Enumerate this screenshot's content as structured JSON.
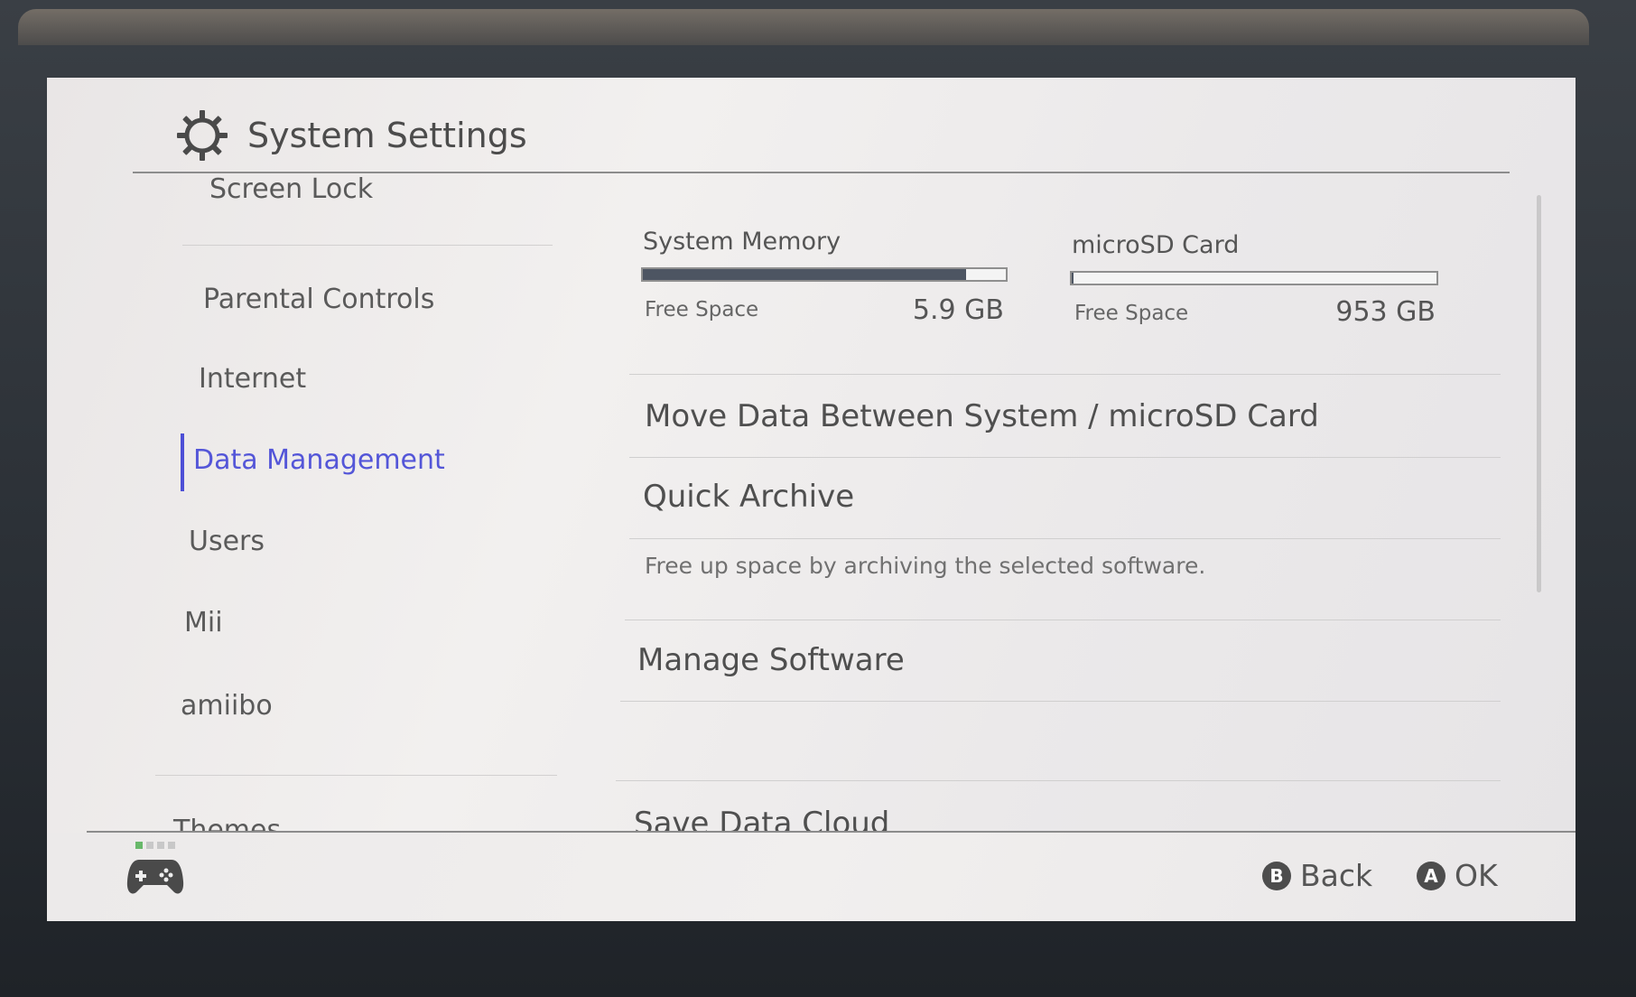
{
  "header": {
    "title": "System Settings",
    "icon": "gear-icon"
  },
  "sidebar": {
    "items": [
      {
        "label": "Screen Lock",
        "active": false
      },
      {
        "label": "Parental Controls",
        "active": false
      },
      {
        "label": "Internet",
        "active": false
      },
      {
        "label": "Data Management",
        "active": true
      },
      {
        "label": "Users",
        "active": false
      },
      {
        "label": "Mii",
        "active": false
      },
      {
        "label": "amiibo",
        "active": false
      },
      {
        "label": "Themes",
        "active": false
      }
    ]
  },
  "storage": {
    "system": {
      "label": "System Memory",
      "free_label": "Free Space",
      "free_value": "5.9 GB",
      "used_fraction": 0.89
    },
    "sd": {
      "label": "microSD Card",
      "free_label": "Free Space",
      "free_value": "953 GB",
      "used_fraction": 0.005
    }
  },
  "main": {
    "items": [
      {
        "label": "Move Data Between System / microSD Card"
      },
      {
        "label": "Quick Archive",
        "description": "Free up space by archiving the selected software."
      },
      {
        "label": "Manage Software"
      },
      {
        "label": "Save Data Cloud"
      }
    ]
  },
  "footer": {
    "back": {
      "key": "B",
      "label": "Back"
    },
    "ok": {
      "key": "A",
      "label": "OK"
    }
  },
  "colors": {
    "accent": "#5456d8",
    "bar_fill": "#4d5562",
    "player_light": "#68b86a"
  }
}
